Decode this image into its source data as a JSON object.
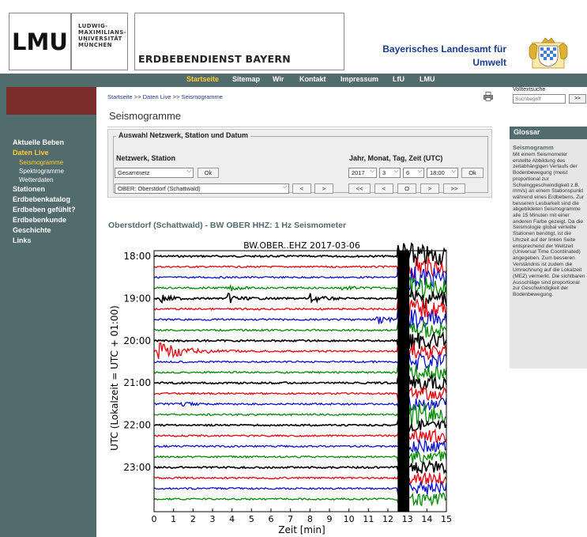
{
  "header": {
    "logo_lmu": "LMU",
    "logo_uni_lines": [
      "LUDWIG-",
      "MAXIMILIANS-",
      "UNIVERSITÄT",
      "MÜNCHEN"
    ],
    "service_title": "ERDBEBENDIENST BAYERN",
    "lfu_line1": "Bayerisches Landesamt für",
    "lfu_line2": "Umwelt",
    "crest_icon": "bavarian-coat-of-arms-icon"
  },
  "nav": {
    "items": [
      "Startseite",
      "Sitemap",
      "Wir",
      "Kontakt",
      "Impressum",
      "LfU",
      "LMU"
    ],
    "active": "Startseite",
    "active_color": "#ffcc33",
    "bg_color": "#526b6c"
  },
  "sidebar": {
    "items": [
      {
        "label": "Aktuelle Beben",
        "level": 0,
        "active": false
      },
      {
        "label": "Daten Live",
        "level": 0,
        "active": true
      },
      {
        "label": "Seismogramme",
        "level": 1,
        "active": true
      },
      {
        "label": "Spektrogramme",
        "level": 1,
        "active": false
      },
      {
        "label": "Wetterdaten",
        "level": 1,
        "active": false
      },
      {
        "label": "Stationen",
        "level": 0,
        "active": false
      },
      {
        "label": "Erdbebenkatalog",
        "level": 0,
        "active": false
      },
      {
        "label": "Erdbeben gefühlt?",
        "level": 0,
        "active": false
      },
      {
        "label": "Erdbebenkunde",
        "level": 0,
        "active": false
      },
      {
        "label": "Geschichte",
        "level": 0,
        "active": false
      },
      {
        "label": "Links",
        "level": 0,
        "active": false
      }
    ]
  },
  "breadcrumb": {
    "items": [
      "Startseite",
      "Daten Live",
      "Seismogramme"
    ],
    "separator": ">>"
  },
  "main": {
    "page_title": "Seismogramme",
    "form": {
      "legend": "Auswahl Netzwerk, Station und Datum",
      "network_label": "Netzwerk, Station",
      "network_value": "Gesamtnetz",
      "ok_label": "Ok",
      "station_value": "OBER: Oberstdorf (Schattwald)",
      "prev_label": "<",
      "next_label": ">",
      "date_label": "Jahr, Monat, Tag, Zeit (UTC)",
      "year": "2017",
      "month": "3",
      "day": "6",
      "time": "18:00",
      "nav_first": "<<",
      "nav_prev": "<",
      "nav_now": "O",
      "nav_next": ">",
      "nav_last": ">>"
    },
    "subtitle": "Oberstdorf (Schattwald) - BW OBER HHZ: 1 Hz Seismometer"
  },
  "chart_data": {
    "type": "line",
    "title": "BW.OBER..EHZ 2017-03-06",
    "xlabel": "Zeit  [min]",
    "ylabel": "UTC (Lokalzeit = UTC + 01:00)",
    "xlim": [
      0,
      15
    ],
    "x_ticks": [
      "0",
      "1",
      "2",
      "3",
      "4",
      "5",
      "6",
      "7",
      "8",
      "9",
      "10",
      "11",
      "12",
      "13",
      "14",
      "15"
    ],
    "y_tick_labels": [
      "18:00",
      "19:00",
      "20:00",
      "21:00",
      "22:00",
      "23:00"
    ],
    "trace_interval_minutes": 15,
    "trace_start": "18:00",
    "trace_count": 24,
    "trace_colors": [
      "#000000",
      "#e8000b",
      "#0a10cc",
      "#008a00"
    ],
    "events": [
      {
        "trace": "18:45",
        "minute": 3.9,
        "amplitude": "small"
      },
      {
        "trace": "18:45",
        "minute": 9.7,
        "amplitude": "small"
      },
      {
        "trace": "19:00",
        "minute": 0.3,
        "amplitude": "medium"
      },
      {
        "trace": "19:00",
        "minute": 3.8,
        "amplitude": "medium"
      },
      {
        "trace": "19:00",
        "minute": 8.0,
        "amplitude": "medium"
      },
      {
        "trace": "19:30",
        "minute": 11.4,
        "amplitude": "medium"
      },
      {
        "trace": "20:15",
        "minute": 0.2,
        "amplitude": "large"
      },
      {
        "trace": "21:30",
        "minute": 1.4,
        "amplitude": "small"
      },
      {
        "trace": "21:45",
        "minute": 13.2,
        "amplitude": "large"
      },
      {
        "trace": "18:00",
        "minute": 12.5,
        "amplitude": "saturated",
        "until_trace": "23:45"
      }
    ]
  },
  "right": {
    "search_label": "Volltextsuche",
    "search_placeholder": "Suchbegriff",
    "search_button": ">>",
    "glossar_title": "Glossar",
    "glossar_term": "Seismogramm",
    "glossar_text": "Mit einem Seismometer erstellte Abbildung des zeitabhängigen Verlaufs der Bodenbewegung (meist proportional zur Schwinggeschwindigkeit z.B. mm/s) an einem Stationspunkt während eines Erdbebens. Zur besseren Lesbarkeit sind die abgebildeten Seismogramme alle 15 Minuten mit einer anderen Farbe gezeigt. Da die Seismologie global verteilte Stationen benötigt, ist die Uhrzeit auf der linken Seite entsprechend der Weltzeit (Universal Time Coordinated) angegeben. Zum besseren Verständnis ist zudem die Umrechnung auf die Lokalzeit (MEZ) vermerkt. Die sichtbaren Ausschläge sind proportional zur Geschwindigkeit der Bodenbewegung."
  }
}
